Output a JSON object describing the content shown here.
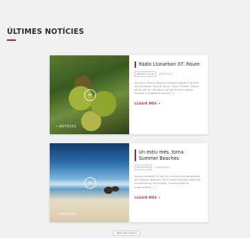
{
  "section": {
    "title": "ÚLTIMES NOTÍCIES"
  },
  "articles": [
    {
      "title": "Ràdio Llunarbori 07: Roure",
      "category": "RÀDIO LLUN",
      "date": "26/04/2023",
      "excerpt": "Arriba la ràdio a Ràdio Llunarbori gràcies a la gent de Llunarbori, amb el Roure, Lluna i Arbori. Parlem de la natura i del bosc i de tot el que hi passa. Escolta el programa sencer [...]",
      "read_more": "LLEGIR MÉS",
      "image_tag": "• NOTÍCIES",
      "image_icon": "link-icon"
    },
    {
      "title": "Un estiu més, torna Summer Beaches",
      "category": "NOTÍCIES",
      "date": "24/06/2023",
      "excerpt": "Aquest dissabte 24 de juny arrenca la programació de Summer Beaches 2023, amb activitats cada cap de setmana a les platges. Consulta tota la programació [...]",
      "read_more": "LLEGIR MÉS",
      "image_tag": "• NOTÍCIES",
      "image_icon": "link-icon"
    }
  ],
  "more_button": {
    "label": "MÉS NOTÍCIES"
  },
  "colors": {
    "accent": "#c8102e",
    "background": "#f1f1f1"
  }
}
